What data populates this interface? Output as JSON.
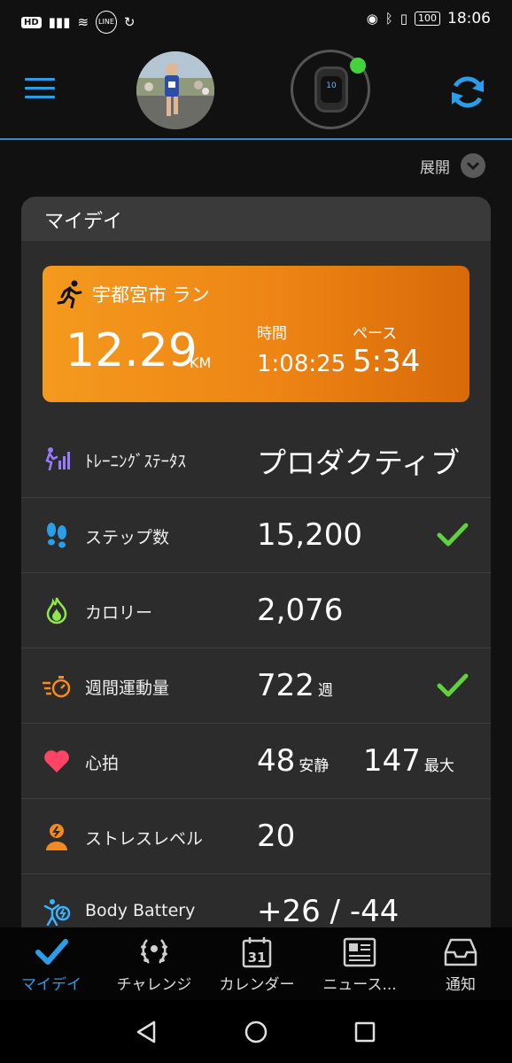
{
  "status_bar": {
    "hd": "HD",
    "signal": "▮▮▮",
    "wifi": "≋",
    "line_badge": "LINE",
    "sync": "↻",
    "eye": "◉",
    "bluetooth": "ᛒ",
    "vibrate": "▯",
    "battery": "100",
    "time": "18:06"
  },
  "header": {
    "menu_icon": "hamburger-menu-icon",
    "avatar_icon": "profile-avatar",
    "device_icon": "watch-icon",
    "watch_face": "10",
    "sync_icon": "sync-icon",
    "accent": "#2a9ee8",
    "device_status_color": "#46d23c"
  },
  "expand": {
    "label": "展開"
  },
  "card": {
    "title": "マイデイ",
    "activity": {
      "name": "宇都宮市 ラン",
      "distance": "12.29",
      "unit": "KM",
      "time_label": "時間",
      "time_value": "1:08:25",
      "pace_label": "ペース",
      "pace_value": "5:34",
      "color": "#ef8a16"
    },
    "rows": {
      "training": {
        "label": "ﾄﾚｰﾆﾝｸﾞｽﾃｰﾀｽ",
        "value": "プロダクティブ",
        "icon_color": "#9a7bff"
      },
      "steps": {
        "label": "ステップ数",
        "value": "15,200",
        "icon_color": "#2a9ee8",
        "check": true
      },
      "calories": {
        "label": "カロリー",
        "value": "2,076",
        "icon_color": "#8ee84c"
      },
      "intensity": {
        "label": "週間運動量",
        "value": "722",
        "unit": "週",
        "icon_color": "#ff8a1a",
        "check": true
      },
      "heart": {
        "label": "心拍",
        "value": "48",
        "unit": "安静",
        "value2": "147",
        "unit2": "最大",
        "icon_color": "#ff4466"
      },
      "stress": {
        "label": "ストレスレベル",
        "value": "20",
        "icon_color": "#f48a1e"
      },
      "battery": {
        "label": "Body Battery",
        "value": "+26 / -44",
        "icon_color": "#3ab2ff"
      }
    },
    "check_color": "#5fd23c"
  },
  "bottom_nav": [
    {
      "label": "マイデイ",
      "icon": "checkmark-icon",
      "active": true
    },
    {
      "label": "チャレンジ",
      "icon": "laurel-icon",
      "active": false
    },
    {
      "label": "カレンダー",
      "icon": "calendar-icon",
      "day": "31",
      "active": false
    },
    {
      "label": "ニュース...",
      "icon": "newsfeed-icon",
      "active": false
    },
    {
      "label": "通知",
      "icon": "inbox-icon",
      "active": false
    }
  ]
}
